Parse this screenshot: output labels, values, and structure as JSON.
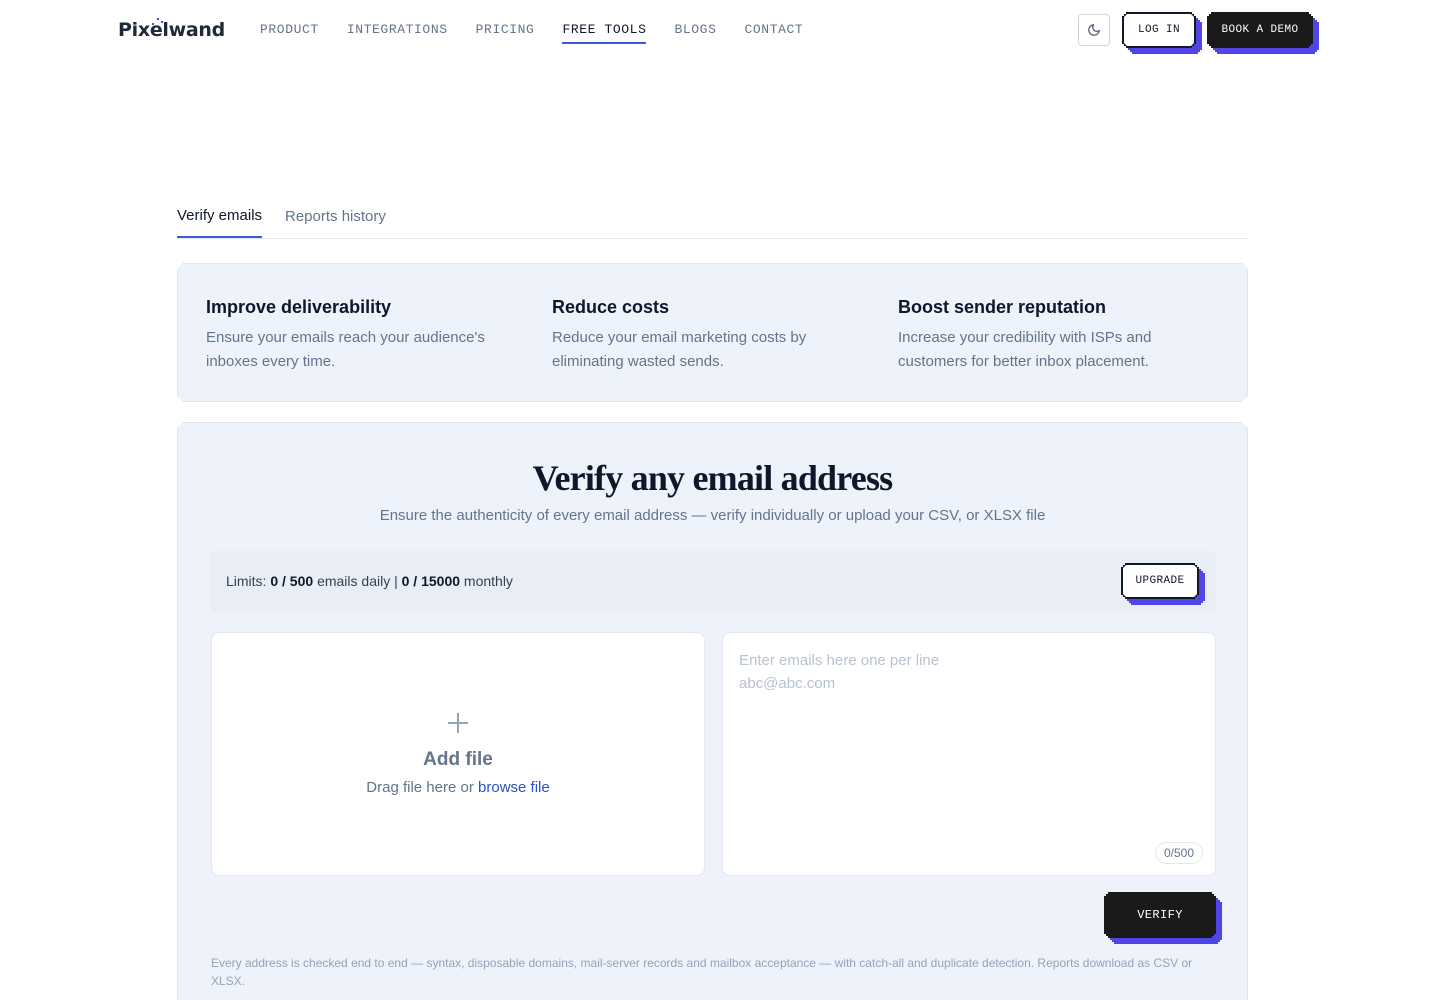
{
  "nav": {
    "logo_text_a": "Pi",
    "logo_text_b": "x",
    "logo_text_c": "elwand",
    "items": [
      {
        "label": "PRODUCT"
      },
      {
        "label": "INTEGRATIONS"
      },
      {
        "label": "PRICING"
      },
      {
        "label": "FREE TOOLS",
        "active": true
      },
      {
        "label": "BLOGS"
      },
      {
        "label": "CONTACT"
      }
    ],
    "theme_icon": "moon-icon",
    "login_label": "LOG IN",
    "demo_label": "BOOK A DEMO"
  },
  "tabs": [
    {
      "label": "Verify emails",
      "active": true
    },
    {
      "label": "Reports history"
    }
  ],
  "benefits": [
    {
      "title": "Improve deliverability",
      "text": "Ensure your emails reach your audience's inboxes every time."
    },
    {
      "title": "Reduce costs",
      "text": "Reduce your email marketing costs by eliminating wasted sends."
    },
    {
      "title": "Boost sender reputation",
      "text": "Increase your credibility with ISPs and customers for better inbox placement."
    }
  ],
  "verify": {
    "title": "Verify any email address",
    "subtitle": "Ensure the authenticity of every email address — verify individually or upload your CSV, or XLSX file",
    "limits": {
      "prefix": "Limits:",
      "daily": "0 / 500",
      "daily_suffix": "emails daily |",
      "monthly": "0 / 15000",
      "monthly_suffix": "monthly"
    },
    "upgrade_label": "UPGRADE",
    "dropzone": {
      "icon": "plus-icon",
      "title": "Add file",
      "drag_text": "Drag file here or",
      "browse_link": "browse file"
    },
    "emails": {
      "value": "",
      "placeholder": "Enter emails here one per line\nabc@abc.com",
      "counter": "0/500"
    },
    "verify_label": "VERIFY",
    "footnote": "Every address is checked end to end — syntax, disposable domains, mail-server records and mailbox acceptance — with catch-all and duplicate detection. Reports download as CSV or XLSX."
  },
  "colors": {
    "accent": "#3b5bdb",
    "button_shadow": "#4f46e5",
    "panel_bg": "#eef2fb",
    "link": "#2b52c4"
  }
}
